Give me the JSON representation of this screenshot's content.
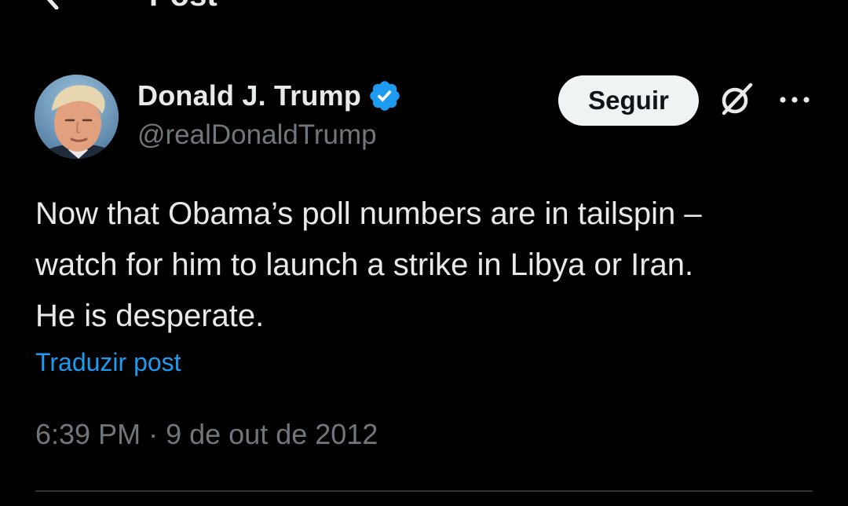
{
  "header": {
    "title": "Post",
    "back_icon": "back-arrow-icon"
  },
  "author": {
    "display_name": "Donald J. Trump",
    "handle": "@realDonaldTrump",
    "verified_icon": "verified-badge-icon",
    "verified_color": "#1d9bf0",
    "avatar_icon": "avatar"
  },
  "actions": {
    "follow_label": "Seguir",
    "grok_icon": "grok-icon",
    "more_icon": "more-options-icon"
  },
  "tweet": {
    "lines": [
      "Now that Obama’s poll numbers are in tailspin –",
      "watch for him to launch a strike in Libya or Iran.",
      "He is desperate."
    ],
    "translate_label": "Traduzir post",
    "time": "6:39 PM",
    "separator": "·",
    "date": "9 de out de 2012"
  },
  "colors": {
    "background": "#000000",
    "primary_text": "#e7e9ea",
    "secondary_text": "#71767b",
    "link": "#1d9bf0",
    "follow_button_bg": "#eff3f4",
    "follow_button_text": "#0f1419",
    "divider": "#2f3336"
  }
}
